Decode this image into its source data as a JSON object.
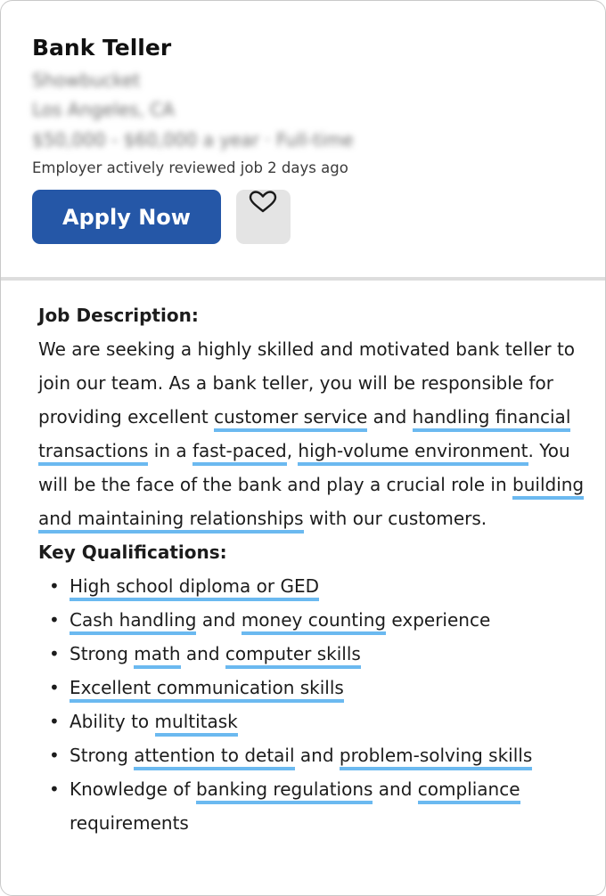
{
  "job": {
    "title": "Bank Teller",
    "company": "Showbucket",
    "location": "Los Angeles, CA",
    "salary": "$50,000 - $60,000 a year · Full-time",
    "reviewed": "Employer actively reviewed job 2 days ago",
    "apply_label": "Apply Now"
  },
  "description": {
    "heading": "Job Description:",
    "segments": [
      {
        "t": "We are seeking a highly skilled and motivated bank teller to join our team. As a bank teller, you will be responsible for providing excellent ",
        "hl": false
      },
      {
        "t": "customer service",
        "hl": true
      },
      {
        "t": " and ",
        "hl": false
      },
      {
        "t": "handling financial transactions",
        "hl": true
      },
      {
        "t": " in a ",
        "hl": false
      },
      {
        "t": "fast-paced",
        "hl": true
      },
      {
        "t": ", ",
        "hl": false
      },
      {
        "t": "high-volume environment",
        "hl": true
      },
      {
        "t": ". You will be the face of the bank and play a crucial role in ",
        "hl": false
      },
      {
        "t": "building and maintaining relationships",
        "hl": true
      },
      {
        "t": " with our customers.",
        "hl": false
      }
    ]
  },
  "qualifications": {
    "heading": "Key Qualifications:",
    "items": [
      [
        {
          "t": "High school diploma or GED",
          "hl": true
        }
      ],
      [
        {
          "t": "Cash handling",
          "hl": true
        },
        {
          "t": " and ",
          "hl": false
        },
        {
          "t": "money counting",
          "hl": true
        },
        {
          "t": " experience",
          "hl": false
        }
      ],
      [
        {
          "t": "Strong ",
          "hl": false
        },
        {
          "t": "math",
          "hl": true
        },
        {
          "t": " and ",
          "hl": false
        },
        {
          "t": "computer skills",
          "hl": true
        }
      ],
      [
        {
          "t": "Excellent communication skills",
          "hl": true
        }
      ],
      [
        {
          "t": "Ability to ",
          "hl": false
        },
        {
          "t": "multitask",
          "hl": true
        }
      ],
      [
        {
          "t": "Strong ",
          "hl": false
        },
        {
          "t": "attention to detail",
          "hl": true
        },
        {
          "t": " and ",
          "hl": false
        },
        {
          "t": "problem-solving skills",
          "hl": true
        }
      ],
      [
        {
          "t": "Knowledge of ",
          "hl": false
        },
        {
          "t": "banking regulations",
          "hl": true
        },
        {
          "t": " and ",
          "hl": false
        },
        {
          "t": "compliance",
          "hl": true
        },
        {
          "t": " requirements",
          "hl": false
        }
      ]
    ]
  },
  "colors": {
    "apply_button": "#2557a7",
    "highlight_underline": "#6bb9f0",
    "save_button_bg": "#e4e4e4"
  },
  "icons": {
    "save": "heart-outline-icon"
  }
}
